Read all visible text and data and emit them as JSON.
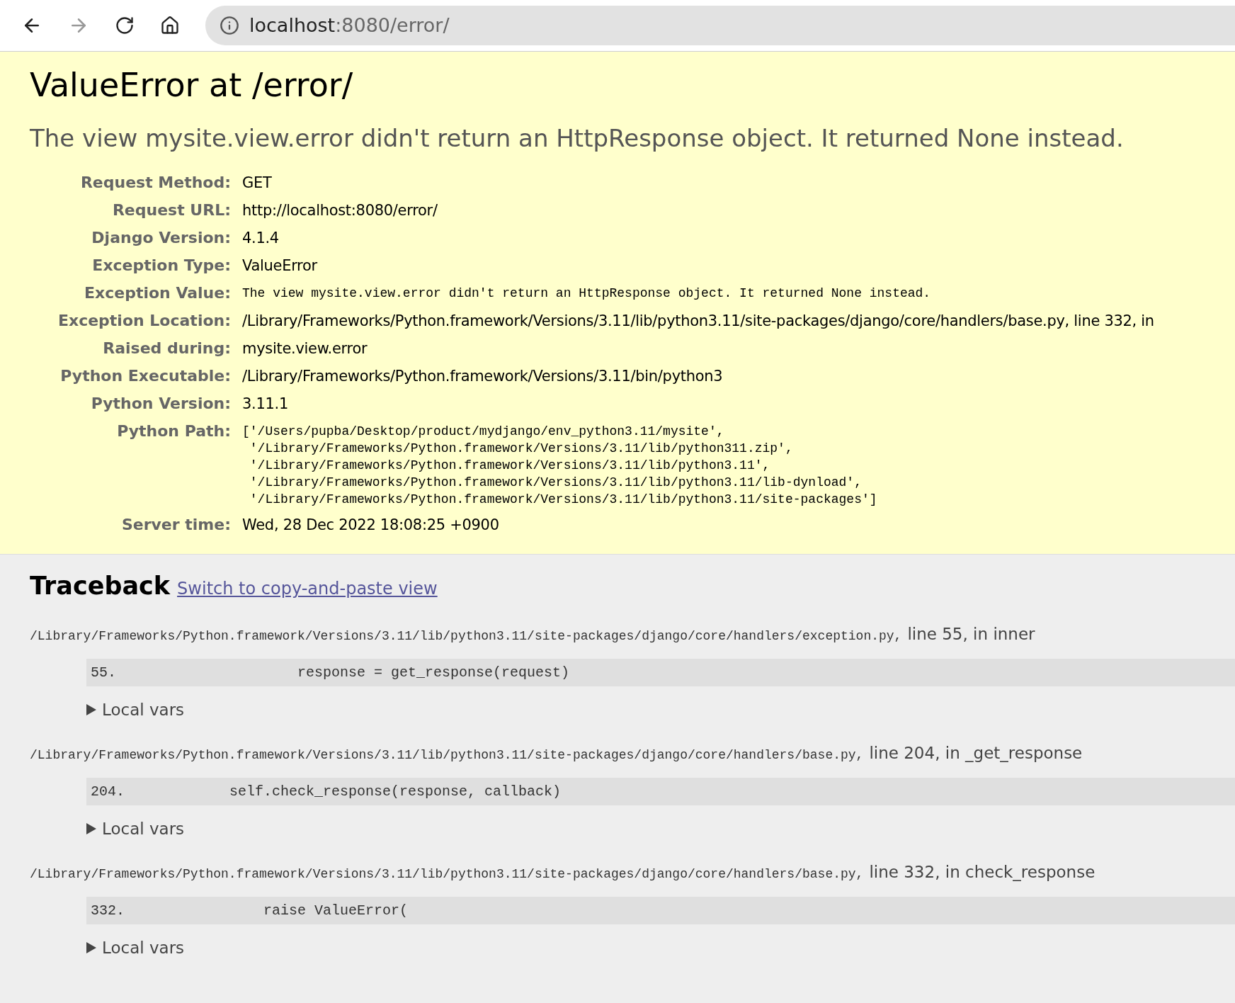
{
  "browser": {
    "url_host": "localhost",
    "url_rest": ":8080/error/"
  },
  "summary": {
    "title": "ValueError at /error/",
    "message": "The view mysite.view.error didn't return an HttpResponse object. It returned None instead.",
    "meta": [
      {
        "label": "Request Method:",
        "value": "GET",
        "kind": "text"
      },
      {
        "label": "Request URL:",
        "value": "http://localhost:8080/error/",
        "kind": "text"
      },
      {
        "label": "Django Version:",
        "value": "4.1.4",
        "kind": "text"
      },
      {
        "label": "Exception Type:",
        "value": "ValueError",
        "kind": "text"
      },
      {
        "label": "Exception Value:",
        "value": "The view mysite.view.error didn't return an HttpResponse object. It returned None instead.",
        "kind": "code"
      },
      {
        "label": "Exception Location:",
        "value": "/Library/Frameworks/Python.framework/Versions/3.11/lib/python3.11/site-packages/django/core/handlers/base.py, line 332, in",
        "kind": "text"
      },
      {
        "label": "Raised during:",
        "value": "mysite.view.error",
        "kind": "text"
      },
      {
        "label": "Python Executable:",
        "value": "/Library/Frameworks/Python.framework/Versions/3.11/bin/python3",
        "kind": "text"
      },
      {
        "label": "Python Version:",
        "value": "3.11.1",
        "kind": "text"
      },
      {
        "label": "Python Path:",
        "value": "['/Users/pupba/Desktop/product/mydjango/env_python3.11/mysite',\n '/Library/Frameworks/Python.framework/Versions/3.11/lib/python311.zip',\n '/Library/Frameworks/Python.framework/Versions/3.11/lib/python3.11',\n '/Library/Frameworks/Python.framework/Versions/3.11/lib/python3.11/lib-dynload',\n '/Library/Frameworks/Python.framework/Versions/3.11/lib/python3.11/site-packages']",
        "kind": "code"
      },
      {
        "label": "Server time:",
        "value": "Wed, 28 Dec 2022 18:08:25 +0900",
        "kind": "text"
      }
    ]
  },
  "traceback": {
    "title": "Traceback",
    "switch_link": "Switch to copy-and-paste view",
    "frames": [
      {
        "file": "/Library/Frameworks/Python.framework/Versions/3.11/lib/python3.11/site-packages/django/core/handlers/exception.py,",
        "where": "line 55, in inner",
        "line_no": "55.",
        "code": "                response = get_response(request)",
        "local_vars": {
          "label": "Local vars",
          "expanded": false
        }
      },
      {
        "file": "/Library/Frameworks/Python.framework/Versions/3.11/lib/python3.11/site-packages/django/core/handlers/base.py,",
        "where": "line 204, in _get_response",
        "line_no": "204.",
        "code": "        self.check_response(response, callback)",
        "local_vars": {
          "label": "Local vars",
          "expanded": false
        }
      },
      {
        "file": "/Library/Frameworks/Python.framework/Versions/3.11/lib/python3.11/site-packages/django/core/handlers/base.py,",
        "where": "line 332, in check_response",
        "line_no": "332.",
        "code": "            raise ValueError(",
        "local_vars": {
          "label": "Local vars",
          "expanded": false
        }
      }
    ]
  }
}
